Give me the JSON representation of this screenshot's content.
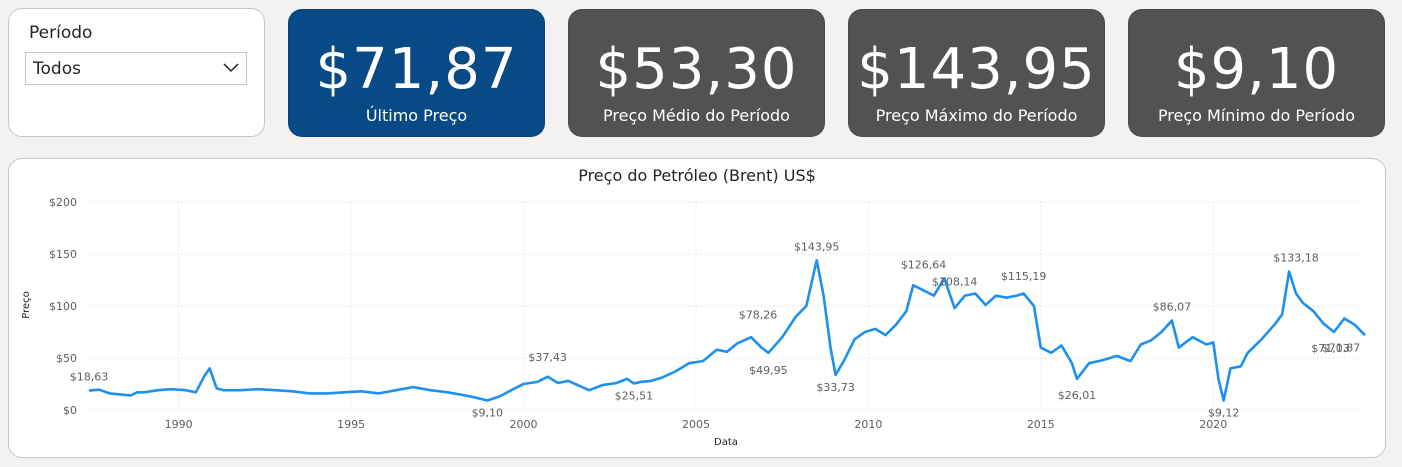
{
  "colors": {
    "primary_kpi": "#074a85",
    "secondary_kpi": "#525252",
    "line": "#1e90ee",
    "label": "#605e5c"
  },
  "filter": {
    "label": "Período",
    "value": "Todos",
    "icon": "chevron-down-icon"
  },
  "kpis": [
    {
      "value": "$71,87",
      "label": "Último Preço"
    },
    {
      "value": "$53,30",
      "label": "Preço Médio do Período"
    },
    {
      "value": "$143,95",
      "label": "Preço Máximo do Período"
    },
    {
      "value": "$9,10",
      "label": "Preço Mínimo do Período"
    }
  ],
  "chart": {
    "title": "Preço do Petróleo (Brent) US$"
  },
  "chart_data": {
    "type": "line",
    "title": "Preço do Petróleo (Brent) US$",
    "xlabel": "Data",
    "ylabel": "Preço",
    "xlim": [
      1987.4,
      2024.4
    ],
    "ylim": [
      0,
      200
    ],
    "y_ticks": [
      "$0",
      "$50",
      "$100",
      "$150",
      "$200"
    ],
    "y_tick_values": [
      0,
      50,
      100,
      150,
      200
    ],
    "x_ticks": [
      "1990",
      "1995",
      "2000",
      "2005",
      "2010",
      "2015",
      "2020"
    ],
    "x_tick_values": [
      1990,
      1995,
      2000,
      2005,
      2010,
      2015,
      2020
    ],
    "grid": true,
    "series": [
      {
        "x": [
          1987.4,
          1987.7,
          1988.0,
          1988.3,
          1988.6,
          1988.8,
          1989.0,
          1989.4,
          1989.8,
          1990.2,
          1990.5,
          1990.75,
          1990.9,
          1991.1,
          1991.3,
          1991.8,
          1992.3,
          1992.8,
          1993.3,
          1993.8,
          1994.3,
          1994.8,
          1995.3,
          1995.8,
          1996.3,
          1996.8,
          1997.3,
          1997.8,
          1998.3,
          1998.6,
          1998.95,
          1999.3,
          1999.7,
          2000.0,
          2000.4,
          2000.7,
          2001.0,
          2001.3,
          2001.7,
          2001.9,
          2002.3,
          2002.7,
          2003.0,
          2003.2,
          2003.4,
          2003.7,
          2004.0,
          2004.4,
          2004.8,
          2005.2,
          2005.6,
          2005.9,
          2006.2,
          2006.6,
          2006.9,
          2007.1,
          2007.5,
          2007.9,
          2008.2,
          2008.5,
          2008.7,
          2008.9,
          2009.05,
          2009.3,
          2009.6,
          2009.9,
          2010.2,
          2010.5,
          2010.8,
          2011.1,
          2011.3,
          2011.6,
          2011.9,
          2012.2,
          2012.5,
          2012.8,
          2013.1,
          2013.4,
          2013.7,
          2014.0,
          2014.3,
          2014.5,
          2014.8,
          2015.0,
          2015.3,
          2015.6,
          2015.9,
          2016.05,
          2016.4,
          2016.8,
          2017.2,
          2017.6,
          2017.9,
          2018.2,
          2018.5,
          2018.8,
          2019.0,
          2019.4,
          2019.8,
          2020.0,
          2020.15,
          2020.3,
          2020.5,
          2020.8,
          2021.0,
          2021.4,
          2021.8,
          2022.0,
          2022.2,
          2022.4,
          2022.6,
          2022.9,
          2023.2,
          2023.5,
          2023.8,
          2024.1,
          2024.4
        ],
        "y": [
          18.63,
          19.5,
          16,
          15,
          14,
          17,
          17,
          19,
          20,
          19,
          17,
          33,
          40,
          21,
          19,
          19,
          20,
          19,
          18,
          16,
          16,
          17,
          18,
          16,
          19,
          22,
          19,
          17,
          14,
          12,
          9.1,
          13,
          20,
          25,
          27,
          32,
          26,
          28,
          22,
          19,
          24,
          26,
          30,
          25.51,
          27,
          28,
          31,
          37,
          45,
          47,
          58,
          56,
          64,
          70,
          60,
          55,
          70,
          90,
          100,
          143.95,
          110,
          60,
          33.73,
          48,
          68,
          75,
          78,
          72,
          82,
          95,
          120,
          115,
          110,
          126.64,
          98,
          110,
          112,
          101,
          110,
          108,
          110,
          112,
          100,
          60,
          55,
          62,
          45,
          30,
          45,
          48,
          52,
          47,
          63,
          67,
          75,
          86.07,
          60,
          70,
          63,
          65,
          30,
          9.12,
          40,
          42,
          55,
          68,
          83,
          92,
          133.18,
          112,
          103,
          95,
          83,
          75,
          88,
          82,
          71.87
        ]
      }
    ],
    "annotations": [
      {
        "x": 1987.4,
        "y": 18.63,
        "text": "$18,63"
      },
      {
        "x": 1998.95,
        "y": 9.1,
        "text": "$9,10"
      },
      {
        "x": 2000.7,
        "y": 37.43,
        "text": "$37,43"
      },
      {
        "x": 2003.2,
        "y": 25.51,
        "text": "$25,51"
      },
      {
        "x": 2006.8,
        "y": 78.26,
        "text": "$78,26"
      },
      {
        "x": 2007.1,
        "y": 49.95,
        "text": "$49,95"
      },
      {
        "x": 2008.5,
        "y": 143.95,
        "text": "$143,95"
      },
      {
        "x": 2009.05,
        "y": 33.73,
        "text": "$33,73"
      },
      {
        "x": 2011.6,
        "y": 126.64,
        "text": "$126,64"
      },
      {
        "x": 2012.5,
        "y": 109.96,
        "text": "$108,14"
      },
      {
        "x": 2014.5,
        "y": 115.19,
        "text": "$115,19"
      },
      {
        "x": 2016.05,
        "y": 26.01,
        "text": "$26,01"
      },
      {
        "x": 2018.8,
        "y": 86.07,
        "text": "$86,07"
      },
      {
        "x": 2020.3,
        "y": 9.12,
        "text": "$9,12"
      },
      {
        "x": 2022.4,
        "y": 133.18,
        "text": "$133,18"
      },
      {
        "x": 2023.4,
        "y": 71.03,
        "text": "$71,03"
      },
      {
        "x": 2024.4,
        "y": 71.87,
        "text": "$71,87"
      }
    ]
  }
}
